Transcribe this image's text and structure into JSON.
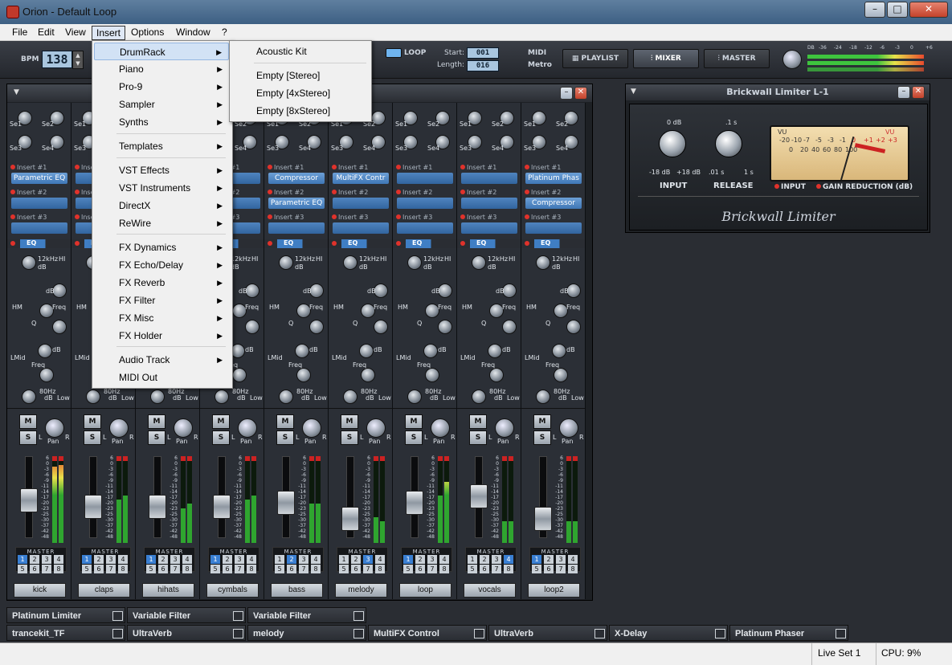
{
  "window": {
    "title": "Orion - Default Loop",
    "controls": [
      "minimize",
      "maximize",
      "close"
    ]
  },
  "menubar": [
    "File",
    "Edit",
    "View",
    "Insert",
    "Options",
    "Window",
    "?"
  ],
  "toolbar": {
    "bpm_label": "BPM",
    "bpm_value": "138",
    "loop_label": "LOOP",
    "start_label": "Start:",
    "start_value": "001",
    "length_label": "Length:",
    "length_value": "016",
    "midi_label": "MIDI",
    "metro_label": "Metro",
    "playlist_label": "PLAYLIST",
    "mixer_label": "MIXER",
    "master_label": "MASTER",
    "db_label": "DB",
    "db_scale": [
      "-36",
      "-24",
      "-18",
      "-12",
      "-6",
      "-3",
      "0",
      "+6"
    ]
  },
  "insert_menu": {
    "items": [
      {
        "label": "DrumRack",
        "submenu": true
      },
      {
        "label": "Piano",
        "submenu": true
      },
      {
        "label": "Pro-9",
        "submenu": true
      },
      {
        "label": "Sampler",
        "submenu": true
      },
      {
        "label": "Synths",
        "submenu": true
      },
      {
        "label": "Templates",
        "submenu": true
      },
      {
        "label": "VST Effects",
        "submenu": true
      },
      {
        "label": "VST Instruments",
        "submenu": true
      },
      {
        "label": "DirectX",
        "submenu": true
      },
      {
        "label": "ReWire",
        "submenu": true
      },
      {
        "label": "FX Dynamics",
        "submenu": true
      },
      {
        "label": "FX Echo/Delay",
        "submenu": true
      },
      {
        "label": "FX Reverb",
        "submenu": true
      },
      {
        "label": "FX Filter",
        "submenu": true
      },
      {
        "label": "FX Misc",
        "submenu": true
      },
      {
        "label": "FX Holder",
        "submenu": true
      },
      {
        "label": "Audio Track",
        "submenu": true
      },
      {
        "label": "MIDI Out",
        "submenu": false
      }
    ]
  },
  "drumrack_submenu": [
    "Acoustic Kit",
    "Empty [Stereo]",
    "Empty [4xStereo]",
    "Empty [8xStereo]"
  ],
  "mixer": {
    "knob_labels": {
      "se1": "Se1",
      "se2": "Se2",
      "se3": "Se3",
      "se4": "Se4"
    },
    "insert_labels": [
      "Insert #1",
      "Insert #2",
      "Insert #3"
    ],
    "eq_label": "EQ",
    "eq_labels": {
      "hi_freq": "12kHz",
      "hi": "HI",
      "db": "dB",
      "hm": "HM",
      "freq": "Freq",
      "q": "Q",
      "lmid": "LMid",
      "low_freq": "80Hz",
      "low": "Low"
    },
    "mute": "M",
    "solo": "S",
    "pan": "Pan",
    "pan_l": "L",
    "pan_r": "R",
    "fader_scale": [
      "6",
      "0",
      "-3",
      "-6",
      "-9",
      "-11",
      "-14",
      "-17",
      "-20",
      "-23",
      "-25",
      "-30",
      "-37",
      "-42",
      "-48"
    ],
    "route_label": "MASTER",
    "route_numbers": [
      "1",
      "2",
      "3",
      "4",
      "5",
      "6",
      "7",
      "8"
    ],
    "channels": [
      {
        "name": "kick",
        "inserts": [
          "Parametric EQ",
          "",
          ""
        ],
        "route": 0
      },
      {
        "name": "claps",
        "inserts": [
          "",
          "",
          ""
        ],
        "route": 0
      },
      {
        "name": "hihats",
        "inserts": [
          "",
          "",
          ""
        ],
        "route": 0
      },
      {
        "name": "cymbals",
        "inserts": [
          "",
          "",
          ""
        ],
        "route": 0
      },
      {
        "name": "bass",
        "inserts": [
          "Compressor",
          "Parametric EQ",
          ""
        ],
        "route": 1
      },
      {
        "name": "melody",
        "inserts": [
          "MultiFX Contr",
          "",
          ""
        ],
        "route": 2
      },
      {
        "name": "loop",
        "inserts": [
          "",
          "",
          ""
        ],
        "route": 0
      },
      {
        "name": "vocals",
        "inserts": [
          "",
          "",
          ""
        ],
        "route": 3
      },
      {
        "name": "loop2",
        "inserts": [
          "Platinum Phas",
          "Compressor",
          ""
        ],
        "route": 0
      }
    ]
  },
  "limiter": {
    "title": "Brickwall Limiter L-1",
    "input_label": "INPUT",
    "release_label": "RELEASE",
    "input_top": "0 dB",
    "input_min": "-18 dB",
    "input_max": "+18 dB",
    "release_top": ".1 s",
    "release_min": ".01 s",
    "release_max": "1 s",
    "vu_label": "VU",
    "vu_scale_top": [
      "-20",
      "-10",
      "-7",
      "-5",
      "-3",
      "-1",
      "0",
      "+1",
      "+2",
      "+3"
    ],
    "vu_scale_bottom": [
      "0",
      "20",
      "40",
      "60",
      "80",
      "100"
    ],
    "led_input": "INPUT",
    "led_gain": "GAIN REDUCTION (dB)",
    "brand": "Brickwall Limiter"
  },
  "docks": {
    "row1": [
      "Platinum Limiter",
      "Variable Filter",
      "Variable Filter"
    ],
    "row2": [
      "trancekit_TF",
      "UltraVerb",
      "melody",
      "MultiFX Control",
      "UltraVerb",
      "X-Delay",
      "Platinum Phaser"
    ]
  },
  "status": {
    "live_set": "Live Set 1",
    "cpu": "CPU: 9%"
  }
}
